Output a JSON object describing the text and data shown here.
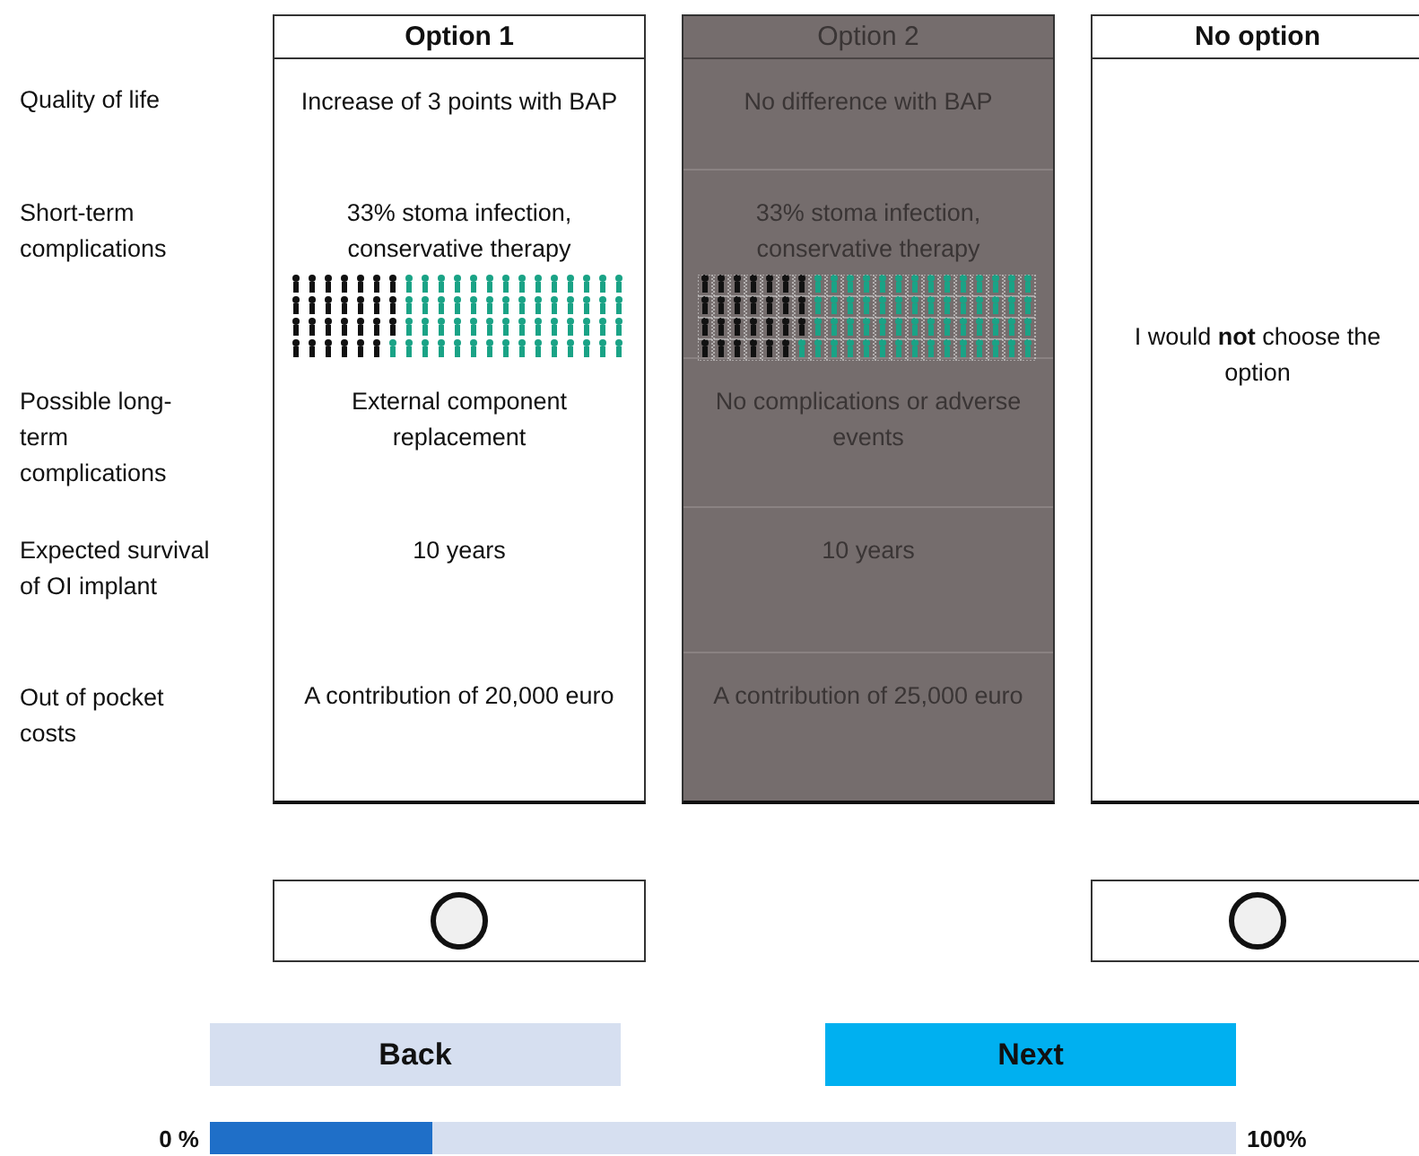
{
  "attributes": [
    "Quality of life",
    "Short-term complications",
    "Possible long-term complications",
    "Expected survival of OI implant",
    "Out of pocket costs"
  ],
  "options": [
    {
      "kind": "option",
      "title": "Option 1",
      "disabled": false,
      "cells": [
        "Increase of 3 points with BAP",
        "33% stoma infection, conservative therapy",
        "External component replacement",
        "10 years",
        "A contribution of 20,000 euro"
      ],
      "radio": {
        "selected": false
      }
    },
    {
      "kind": "option",
      "title": "Option 2",
      "disabled": true,
      "cells": [
        "No difference with BAP",
        "33% stoma infection, conservative therapy",
        "No complications or adverse events",
        "10 years",
        "A contribution of 25,000 euro"
      ]
    },
    {
      "kind": "none",
      "title": "No option",
      "text": "I would **not** choose the option",
      "radio": {
        "selected": false
      }
    }
  ],
  "buttons": [
    {
      "label": "Back",
      "kind": "secondary"
    },
    {
      "label": "Next",
      "kind": "primary"
    }
  ],
  "progress": {
    "start_label": "0 %",
    "end_label": "100%",
    "level": 0.217
  }
}
